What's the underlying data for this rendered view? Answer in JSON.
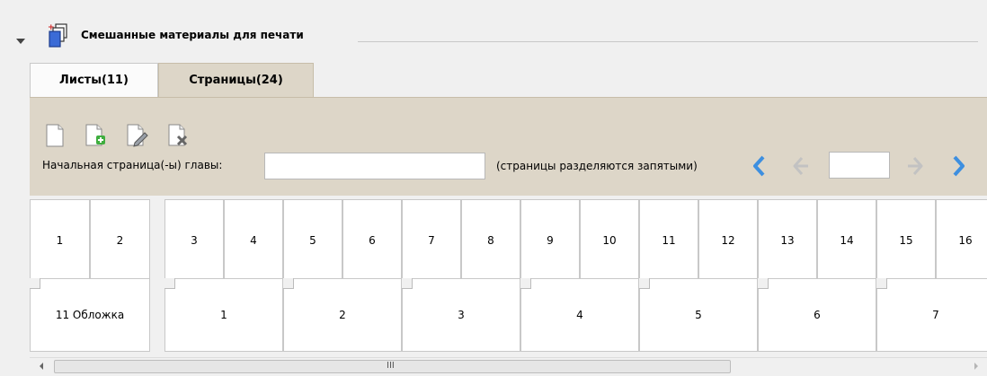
{
  "header": {
    "title": "Смешанные материалы для печати"
  },
  "tabs": [
    {
      "label": "Листы(11)",
      "active": false
    },
    {
      "label": "Страницы(24)",
      "active": true
    }
  ],
  "toolbar": {
    "icons": [
      "new-page-icon",
      "add-page-icon",
      "edit-page-icon",
      "delete-page-icon"
    ],
    "chapter_label": "Начальная страница(-ы) главы:",
    "chapter_value": "",
    "hint": "(страницы разделяются запятыми)",
    "page_value": ""
  },
  "colors": {
    "panel": "#ddd6c8",
    "nav_arrow": "#3d8fe0",
    "nav_arrow_disabled": "#c2c2c2"
  },
  "pages_row": [
    "1",
    "2",
    "3",
    "4",
    "5",
    "6",
    "7",
    "8",
    "9",
    "10",
    "11",
    "12",
    "13",
    "14",
    "15",
    "16"
  ],
  "sheets_row": [
    "11 Обложка",
    "1",
    "2",
    "3",
    "4",
    "5",
    "6",
    "7"
  ],
  "scrollbar": {
    "grip": "III"
  }
}
